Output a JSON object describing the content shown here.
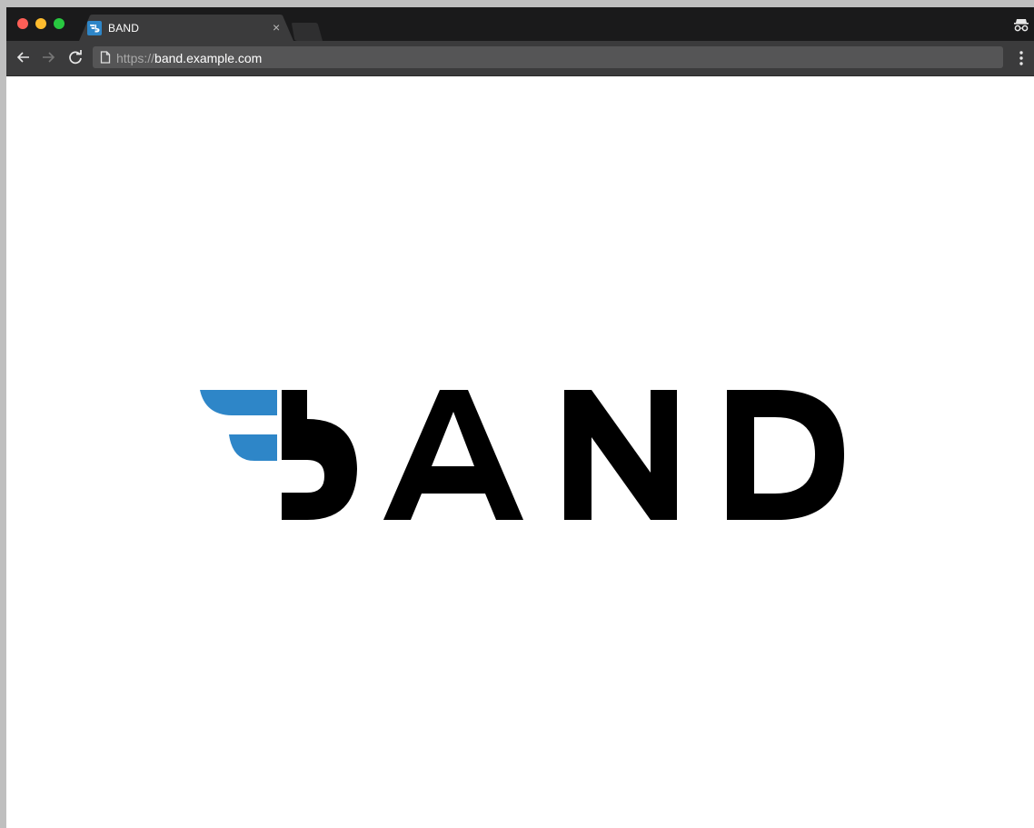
{
  "browser": {
    "tab": {
      "title": "BAND",
      "close_glyph": "×"
    },
    "address_bar": {
      "scheme": "https://",
      "host": "band.example.com"
    },
    "icons": {
      "back": "arrow-left-icon",
      "forward": "arrow-right-icon",
      "reload": "reload-icon",
      "page": "page-icon",
      "menu": "kebab-menu-icon",
      "incognito": "incognito-icon"
    }
  },
  "page": {
    "logo": {
      "wordmark": "BAND",
      "colors": {
        "wing": "#2e86c8",
        "letters": "#000000"
      }
    }
  }
}
